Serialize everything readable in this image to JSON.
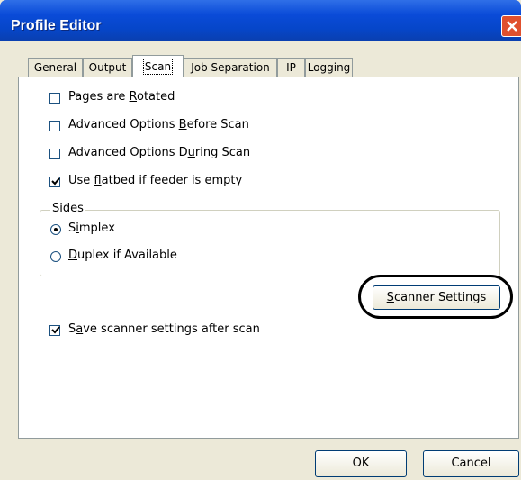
{
  "window": {
    "title": "Profile Editor"
  },
  "tabs": [
    {
      "label": "General"
    },
    {
      "label": "Output"
    },
    {
      "label": "Scan"
    },
    {
      "label": "Job Separation"
    },
    {
      "label": "IP"
    },
    {
      "label": "Logging"
    }
  ],
  "scan": {
    "pages_rotated": {
      "label": "Pages are Rotated",
      "checked": false
    },
    "adv_before": {
      "label": "Advanced Options Before Scan",
      "checked": false
    },
    "adv_during": {
      "label": "Advanced Options During Scan",
      "checked": false
    },
    "use_flatbed": {
      "label": "Use flatbed if feeder is empty",
      "checked": true
    },
    "sides": {
      "label": "Sides",
      "simplex": {
        "label": "Simplex",
        "selected": true
      },
      "duplex": {
        "label": "Duplex if Available",
        "selected": false
      }
    },
    "scanner_settings_label": "Scanner Settings",
    "save_settings": {
      "label": "Save scanner settings after scan",
      "checked": true
    }
  },
  "footer": {
    "ok_label": "OK",
    "cancel_label": "Cancel"
  }
}
